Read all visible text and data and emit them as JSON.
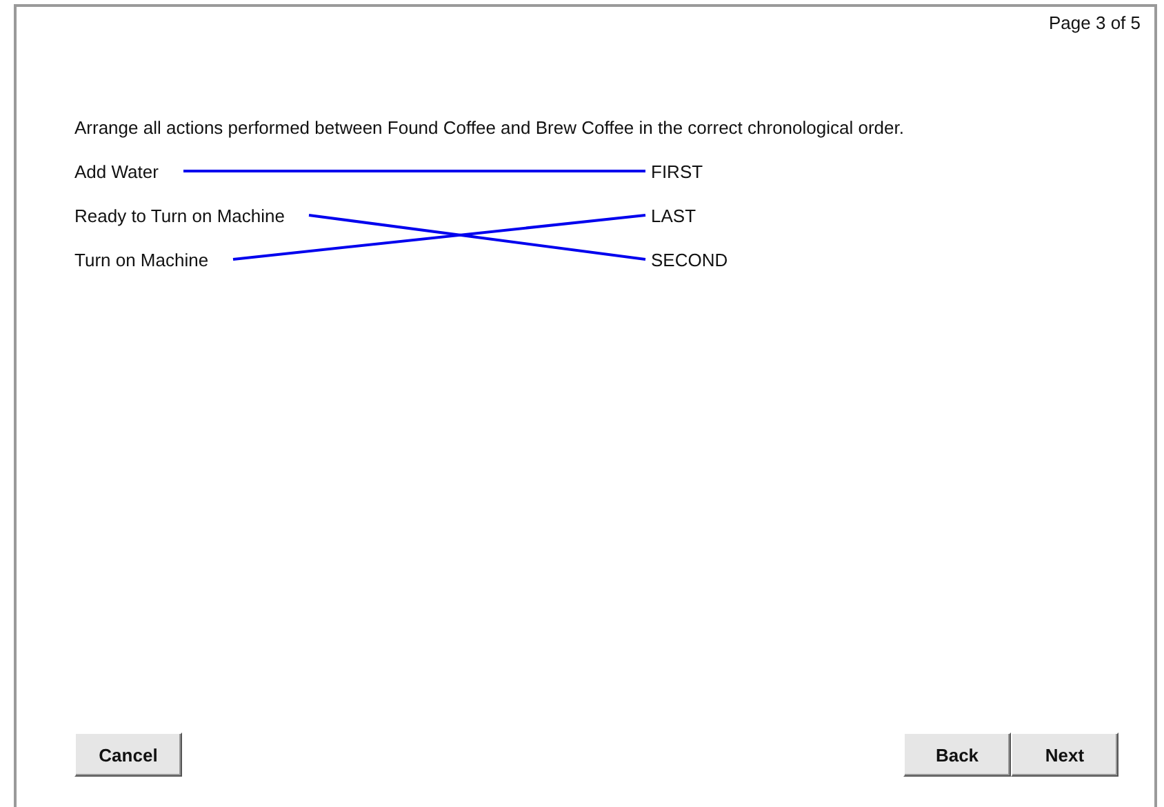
{
  "page_indicator": "Page 3 of 5",
  "instruction": "Arrange all actions performed between Found Coffee and Brew Coffee in the correct chronological order.",
  "left_items": [
    {
      "label": "Add Water",
      "kind": "level"
    },
    {
      "label": "Ready to Turn on Machine",
      "kind": "downone"
    },
    {
      "label": "Turn on Machine",
      "kind": "upone"
    }
  ],
  "right_items": [
    "FIRST",
    "LAST",
    "SECOND"
  ],
  "buttons": [
    {
      "label": "Cancel",
      "kind": "cancel"
    },
    {
      "label": "Back",
      "kind": "back"
    },
    {
      "label": "Next",
      "kind": "next"
    }
  ]
}
